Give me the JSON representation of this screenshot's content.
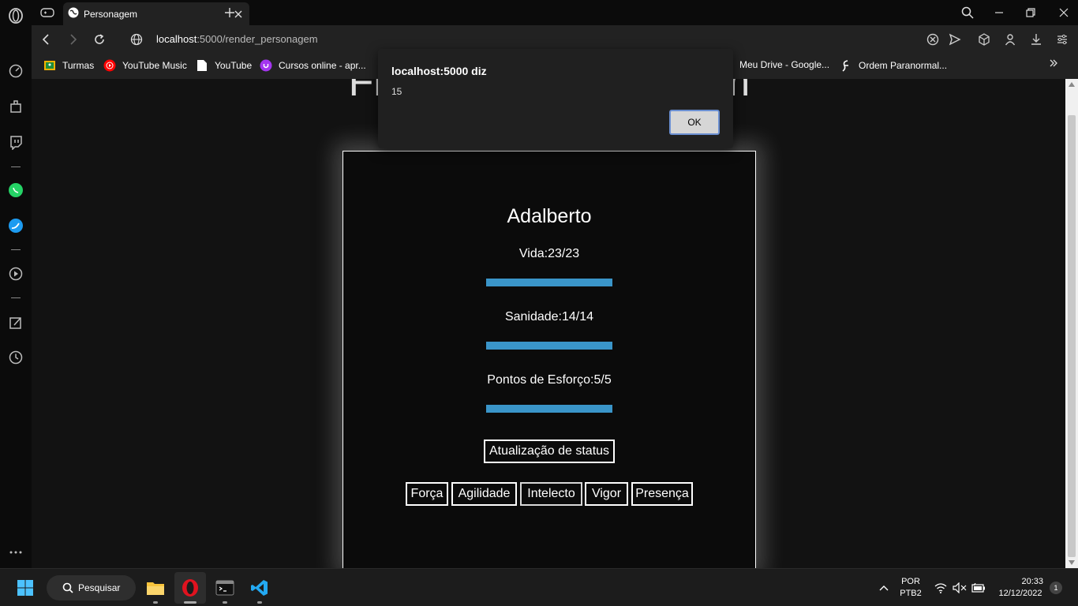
{
  "browser": {
    "tab": {
      "title": "Personagem"
    },
    "address": {
      "host": "localhost",
      "path": ":5000/render_personagem"
    },
    "bookmarks": [
      {
        "label": "Turmas",
        "icon": "classroom-icon"
      },
      {
        "label": "YouTube Music",
        "icon": "youtube-music-icon"
      },
      {
        "label": "YouTube",
        "icon": "document-icon"
      },
      {
        "label": "Cursos online - apr...",
        "icon": "udemy-icon"
      },
      {
        "label": "Meu Drive - Google...",
        "icon": "drive-icon"
      },
      {
        "label": "Ordem Paranormal...",
        "icon": "ordem-icon"
      }
    ]
  },
  "page": {
    "title": "Ficha de Personagem",
    "character": {
      "name": "Adalberto",
      "stats": [
        {
          "label": "Vida:23/23",
          "current": 23,
          "max": 23
        },
        {
          "label": "Sanidade:14/14",
          "current": 14,
          "max": 14
        },
        {
          "label": "Pontos de Esforço:5/5",
          "current": 5,
          "max": 5
        }
      ],
      "update_button": "Atualização de status",
      "attribute_buttons": [
        "Força",
        "Agilidade",
        "Intelecto",
        "Vigor",
        "Presença"
      ]
    }
  },
  "dialog": {
    "title": "localhost:5000 diz",
    "message": "15",
    "ok": "OK"
  },
  "taskbar": {
    "search": "Pesquisar",
    "lang_top": "POR",
    "lang_bottom": "PTB2",
    "time": "20:33",
    "date": "12/12/2022",
    "notifications": "1"
  },
  "colors": {
    "bar_fill": "#3a95c9",
    "page_bg": "#121212",
    "card_bg": "#0b0b0b"
  }
}
